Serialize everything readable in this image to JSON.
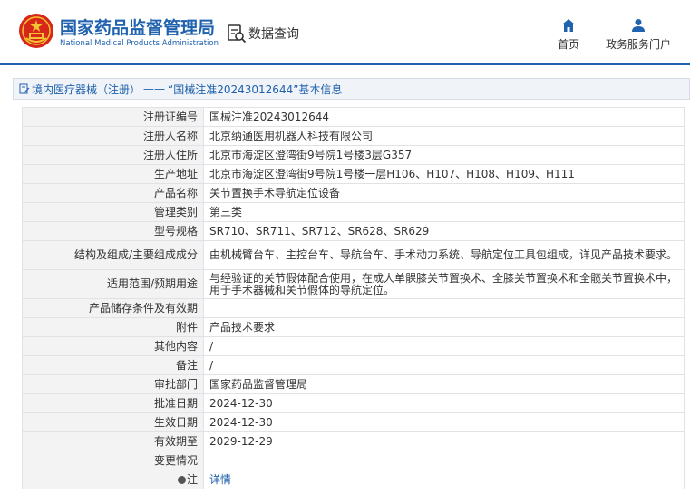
{
  "header": {
    "brand_cn": "国家药品监督管理局",
    "brand_en": "National Medical Products Administration",
    "query_label": "数据查询",
    "nav_home": "首页",
    "nav_gov": "政务服务门户",
    "accent_color": "#1f62ad",
    "emblem_color": "#d7261a"
  },
  "breadcrumb": {
    "category": "境内医疗器械（注册）",
    "separator": "——",
    "current": "“国械注准20243012644”基本信息"
  },
  "record": {
    "rows": [
      {
        "label": "注册证编号",
        "value": "国械注准20243012644"
      },
      {
        "label": "注册人名称",
        "value": "北京纳通医用机器人科技有限公司"
      },
      {
        "label": "注册人住所",
        "value": "北京市海淀区澄湾街9号院1号楼3层G357"
      },
      {
        "label": "生产地址",
        "value": "北京市海淀区澄湾街9号院1号楼一层H106、H107、H108、H109、H111"
      },
      {
        "label": "产品名称",
        "value": "关节置换手术导航定位设备"
      },
      {
        "label": "管理类别",
        "value": "第三类"
      },
      {
        "label": "型号规格",
        "value": "SR710、SR711、SR712、SR628、SR629"
      },
      {
        "label": "结构及组成/主要组成成分",
        "value": "由机械臂台车、主控台车、导航台车、手术动力系统、导航定位工具包组成，详见产品技术要求。"
      },
      {
        "label": "适用范围/预期用途",
        "value": "与经验证的关节假体配合使用，在成人单髁膝关节置换术、全膝关节置换术和全髋关节置换术中，用于手术器械和关节假体的导航定位。"
      },
      {
        "label": "产品储存条件及有效期",
        "value": ""
      },
      {
        "label": "附件",
        "value": "产品技术要求"
      },
      {
        "label": "其他内容",
        "value": "/"
      },
      {
        "label": "备注",
        "value": "/"
      },
      {
        "label": "审批部门",
        "value": "国家药品监督管理局"
      },
      {
        "label": "批准日期",
        "value": "2024-12-30"
      },
      {
        "label": "生效日期",
        "value": "2024-12-30"
      },
      {
        "label": "有效期至",
        "value": "2029-12-29"
      },
      {
        "label": "变更情况",
        "value": ""
      },
      {
        "label": "注",
        "value": "详情"
      }
    ]
  }
}
